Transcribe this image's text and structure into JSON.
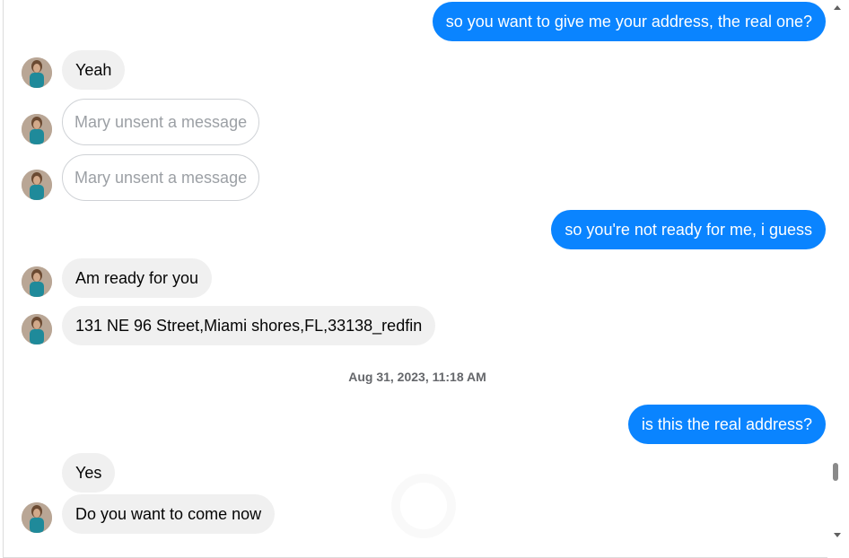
{
  "messages": {
    "m1": "so you want to give me your address, the real one?",
    "m2": "Yeah",
    "m3": "Mary unsent a message",
    "m4": "Mary unsent a message",
    "m5": "so you're not ready for me, i guess",
    "m6": "Am ready for you",
    "m7": "131 NE 96 Street,Miami shores,FL,33138_redfin",
    "timestamp": "Aug 31, 2023, 11:18 AM",
    "m8": "is this the real address?",
    "m9": "Yes",
    "m10": "Do you want to come now"
  },
  "colors": {
    "outgoing_bubble": "#0a84ff",
    "incoming_bubble": "#f0f0f0"
  },
  "icons": {
    "avatar": "avatar-icon",
    "scroll_up": "chevron-up-icon",
    "scroll_down": "chevron-down-icon"
  }
}
